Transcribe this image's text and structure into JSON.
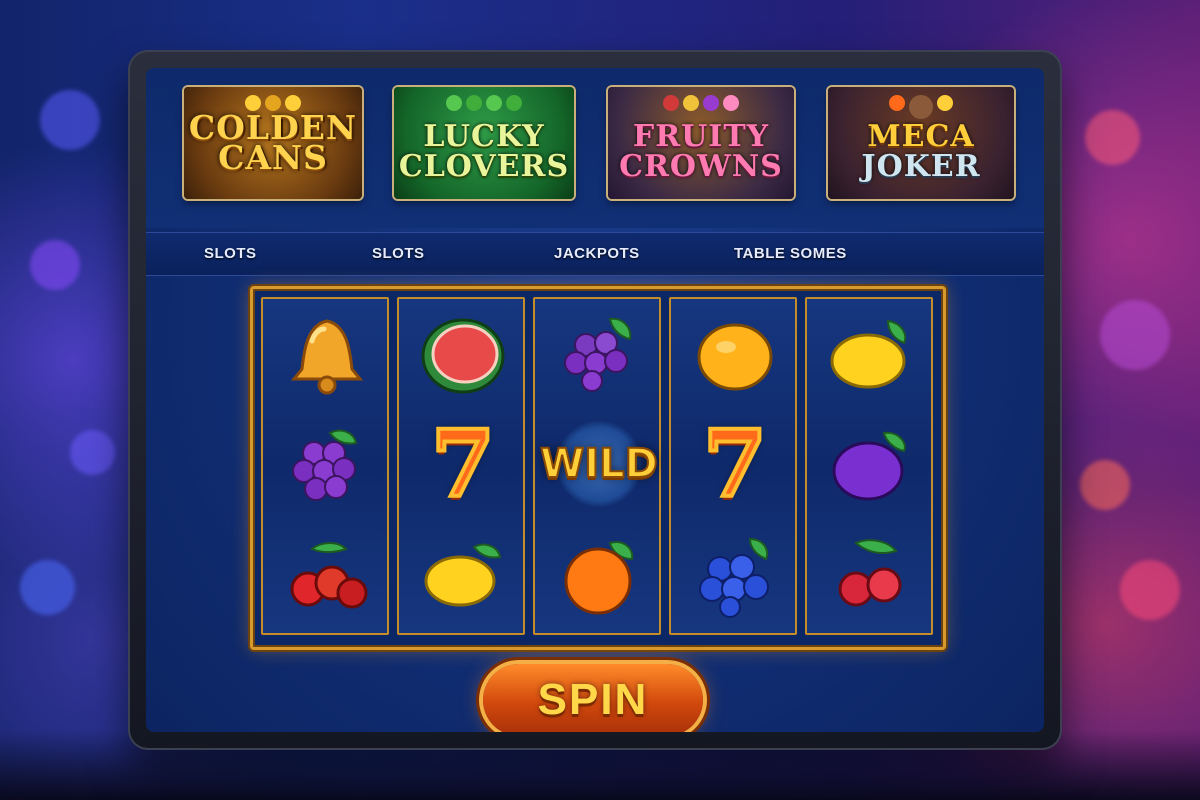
{
  "featured_games": [
    {
      "word1": "COLDEN",
      "word2": "CANS"
    },
    {
      "word1": "LUCKY",
      "word2": "CLOVERS"
    },
    {
      "word1": "FRUITY",
      "word2": "CROWNS"
    },
    {
      "word1": "MECA",
      "word2": "JOKER"
    }
  ],
  "nav": {
    "items": [
      "SLOTS",
      "SLOTS",
      "JACKPOTS",
      "TABLE SOMES"
    ]
  },
  "reels": {
    "seven_symbol": "7",
    "wild_symbol": "WILD",
    "columns": [
      [
        "bell-icon",
        "grapes-icon",
        "cherries-icon"
      ],
      [
        "watermelon-icon",
        "seven",
        "lemon-icon"
      ],
      [
        "grapes-icon",
        "wild",
        "orange-icon"
      ],
      [
        "orange-icon",
        "seven",
        "blackberry-icon"
      ],
      [
        "lemon-icon",
        "plum-icon",
        "cherries-icon"
      ]
    ]
  },
  "spin_button": {
    "label": "SPIN"
  },
  "colors": {
    "frame_gold": "#d79a2c",
    "spin_orange": "#e5621a",
    "screen_blue": "#123077"
  }
}
